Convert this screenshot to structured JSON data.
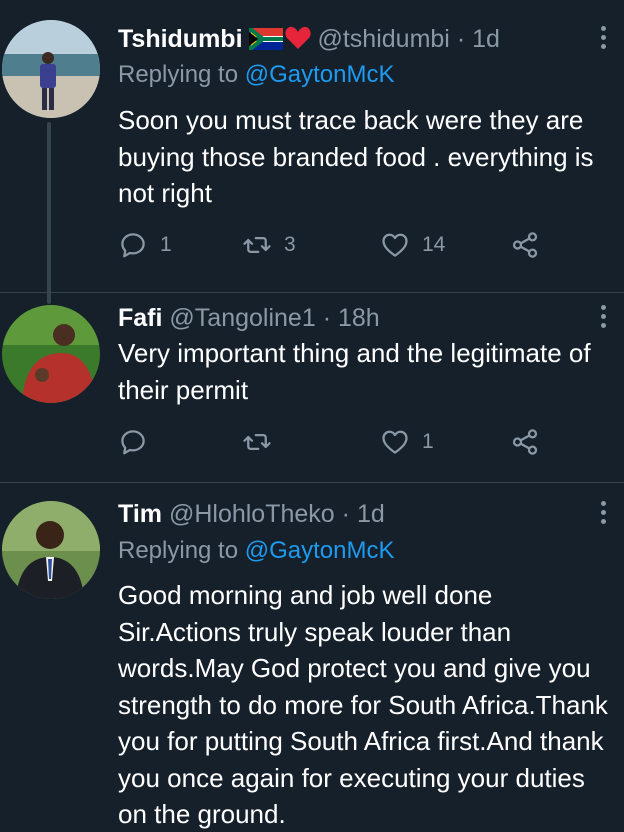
{
  "tweets": [
    {
      "name": "Tshidumbi",
      "handle": "@tshidumbi",
      "separator": "·",
      "time": "1d",
      "replying_prefix": "Replying to ",
      "replying_to": "@GaytonMcK",
      "text": "Soon you must trace back were they are buying those branded food . everything is not right",
      "replies": "1",
      "retweets": "3",
      "likes": "14"
    },
    {
      "name": "Fafi",
      "handle": "@Tangoline1",
      "separator": "·",
      "time": "18h",
      "text": "Very important thing and the legitimate of their permit",
      "replies": "",
      "retweets": "",
      "likes": "1"
    },
    {
      "name": "Tim",
      "handle": "@HlohloTheko",
      "separator": "·",
      "time": "1d",
      "replying_prefix": "Replying to ",
      "replying_to": "@GaytonMcK",
      "text": "Good morning and job well done Sir.Actions truly speak louder than words.May God protect you and give you strength to do more for South Africa.Thank you for putting South Africa first.And thank you once again for executing your duties on the ground."
    }
  ],
  "icons": {
    "reply": "reply-icon",
    "retweet": "retweet-icon",
    "like": "heart-icon",
    "share": "share-icon",
    "more": "more-icon",
    "flag": "south-africa-flag-icon",
    "emoji": "red-heart-icon"
  },
  "colors": {
    "background": "#15202b",
    "text": "#ffffff",
    "muted": "#8b98a5",
    "link": "#1d9bf0",
    "divider": "#38444d"
  }
}
